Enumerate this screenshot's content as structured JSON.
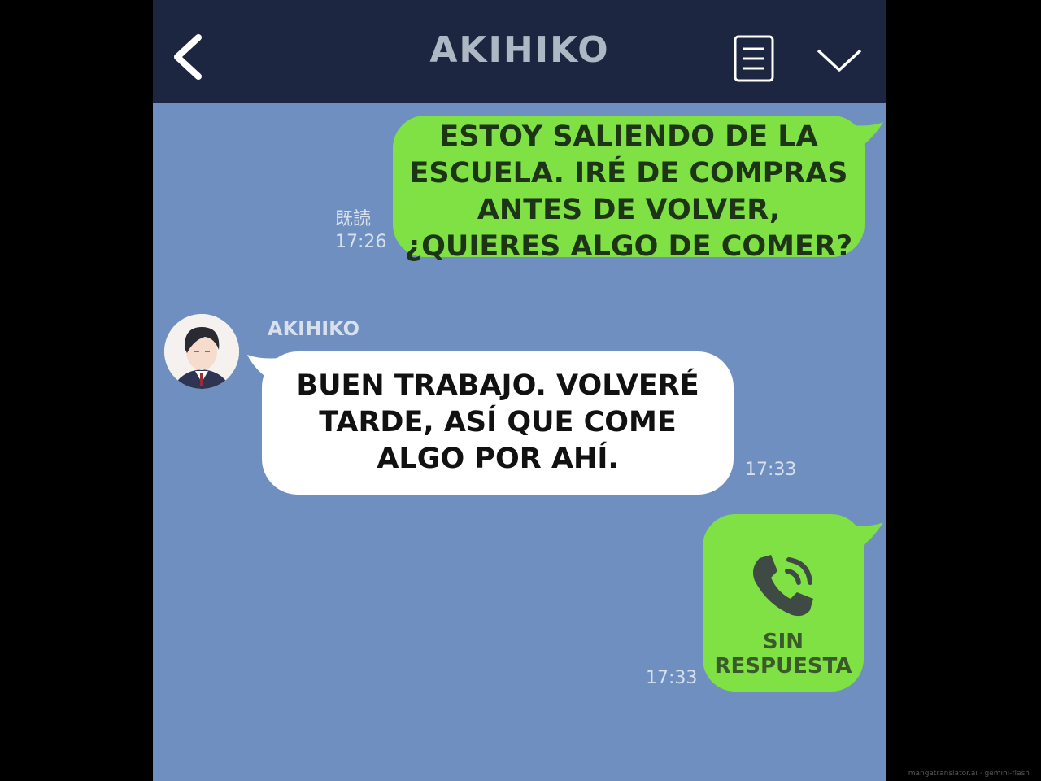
{
  "header": {
    "title": "AKIHIKO",
    "back_icon": "chevron-left-icon",
    "menu_icon": "list-icon",
    "dropdown_icon": "chevron-down-icon"
  },
  "colors": {
    "header_bg": "#1d2640",
    "chat_bg": "#6e8fbf",
    "sent_bubble": "#7fe143",
    "received_bubble": "#ffffff"
  },
  "messages": [
    {
      "direction": "sent",
      "lines": [
        "ESTOY SALIENDO DE LA",
        "ESCUELA. IRÉ DE COMPRAS",
        "ANTES DE VOLVER,",
        "¿QUIERES ALGO DE COMER?"
      ],
      "read_label": "既読",
      "time": "17:26"
    },
    {
      "direction": "received",
      "sender": "AKIHIKO",
      "lines": [
        "BUEN TRABAJO. VOLVERÉ",
        "TARDE, ASÍ QUE COME",
        "ALGO POR AHÍ."
      ],
      "time": "17:33"
    },
    {
      "direction": "sent",
      "type": "call",
      "icon": "phone-icon",
      "lines": [
        "SIN",
        "RESPUESTA"
      ],
      "time": "17:33"
    }
  ],
  "watermark": "mangatranslator.ai · gemini-flash"
}
